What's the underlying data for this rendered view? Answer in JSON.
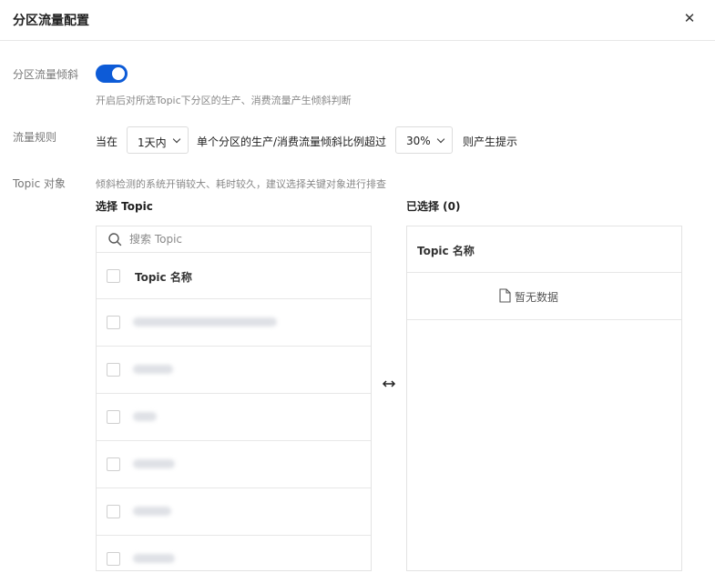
{
  "dialog": {
    "title": "分区流量配置",
    "close_label": "✕"
  },
  "skew": {
    "label": "分区流量倾斜",
    "toggle_on": true,
    "hint": "开启后对所选Topic下分区的生产、消费流量产生倾斜判断"
  },
  "rule": {
    "label": "流量规则",
    "prefix": "当在",
    "period_value": "1天内",
    "middle": "单个分区的生产/消费流量倾斜比例超过",
    "ratio_value": "30%",
    "suffix": "则产生提示"
  },
  "topic": {
    "label": "Topic 对象",
    "hint": "倾斜检测的系统开销较大、耗时较久，建议选择关键对象进行排查"
  },
  "left_panel": {
    "title": "选择 Topic",
    "search_placeholder": "搜索 Topic",
    "column_header": "Topic 名称",
    "rows": [
      {
        "name": ""
      },
      {
        "name": ""
      },
      {
        "name": ""
      },
      {
        "name": ""
      },
      {
        "name": ""
      },
      {
        "name": ""
      }
    ]
  },
  "right_panel": {
    "title": "已选择 (0)",
    "column_header": "Topic 名称",
    "empty_text": "暂无数据"
  },
  "icons": {
    "close": "close-icon",
    "search": "search-icon",
    "transfer": "transfer-arrows-icon",
    "file": "file-icon",
    "chevron": "chevron-down-icon"
  },
  "colors": {
    "accent": "#0d5bd7",
    "border": "#e3e3e3",
    "muted_text": "#888888"
  }
}
